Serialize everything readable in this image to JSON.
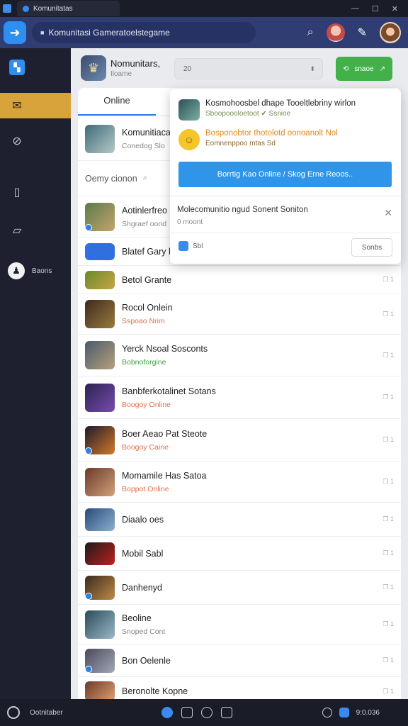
{
  "window": {
    "tab_title": "Komunitatas"
  },
  "address": {
    "url": "Komunitasi Gameratoelstegame"
  },
  "sidebar": {
    "games_label": "Baons"
  },
  "profile": {
    "name": "Nomunitars,",
    "sub": "Iloame"
  },
  "toolbar": {
    "input_value": "20",
    "green_button": "snaoe"
  },
  "tabs": {
    "online": "Online"
  },
  "rows": [
    {
      "title": "Komunitiaca",
      "sub": "Conedog Slo"
    },
    {
      "title": "Oemy cionon",
      "sub": ""
    },
    {
      "title": "Aotinlerfreo",
      "sub": "Shgraef oond"
    },
    {
      "title": "Blatef Gary h",
      "sub": ""
    },
    {
      "title": "Betol Grante",
      "sub": ""
    },
    {
      "title": "Rocol Onlein",
      "sub": "Sspoao Nrim"
    },
    {
      "title": "Yerck Nsoal Sosconts",
      "sub": "Bobnoforgine"
    },
    {
      "title": "Banbferkotalinet Sotans",
      "sub": "Boogoy Online"
    },
    {
      "title": "Boer Aeao Pat Steote",
      "sub": "Boogoy Caine"
    },
    {
      "title": "Momamile Has Satoa",
      "sub": "Boppot Online"
    },
    {
      "title": "Diaalo oes",
      "sub": ""
    },
    {
      "title": "Mobil Sabl",
      "sub": ""
    },
    {
      "title": "Danhenyd",
      "sub": ""
    },
    {
      "title": "Beoline",
      "sub": "Snoped Cont"
    },
    {
      "title": "Bon Oelenle",
      "sub": ""
    },
    {
      "title": "Beronolte Kopne",
      "sub": ""
    }
  ],
  "popup": {
    "item1_title": "Kosmohoosbel dhape Tooeltlebriny wirlon",
    "item1_sub": "Sboopoooloetoot  ✔  Ssnioe",
    "item2_title": "Bosponobtor thotolotd oonoanolt  Nol",
    "item2_sub": "Eomnenppoo mtas  Sd",
    "button": "Borrtig Kao Online / Skog Erne Reoos..",
    "message": "Molecomunitio ngud Sonent Soniton",
    "message_sub": "0  moont",
    "small_label": "Sbl",
    "ghost_button": "Sonbs"
  },
  "taskbar": {
    "label": "Ootnitaber",
    "clock": "9:0.036"
  },
  "status_glyph": "❐ 1"
}
